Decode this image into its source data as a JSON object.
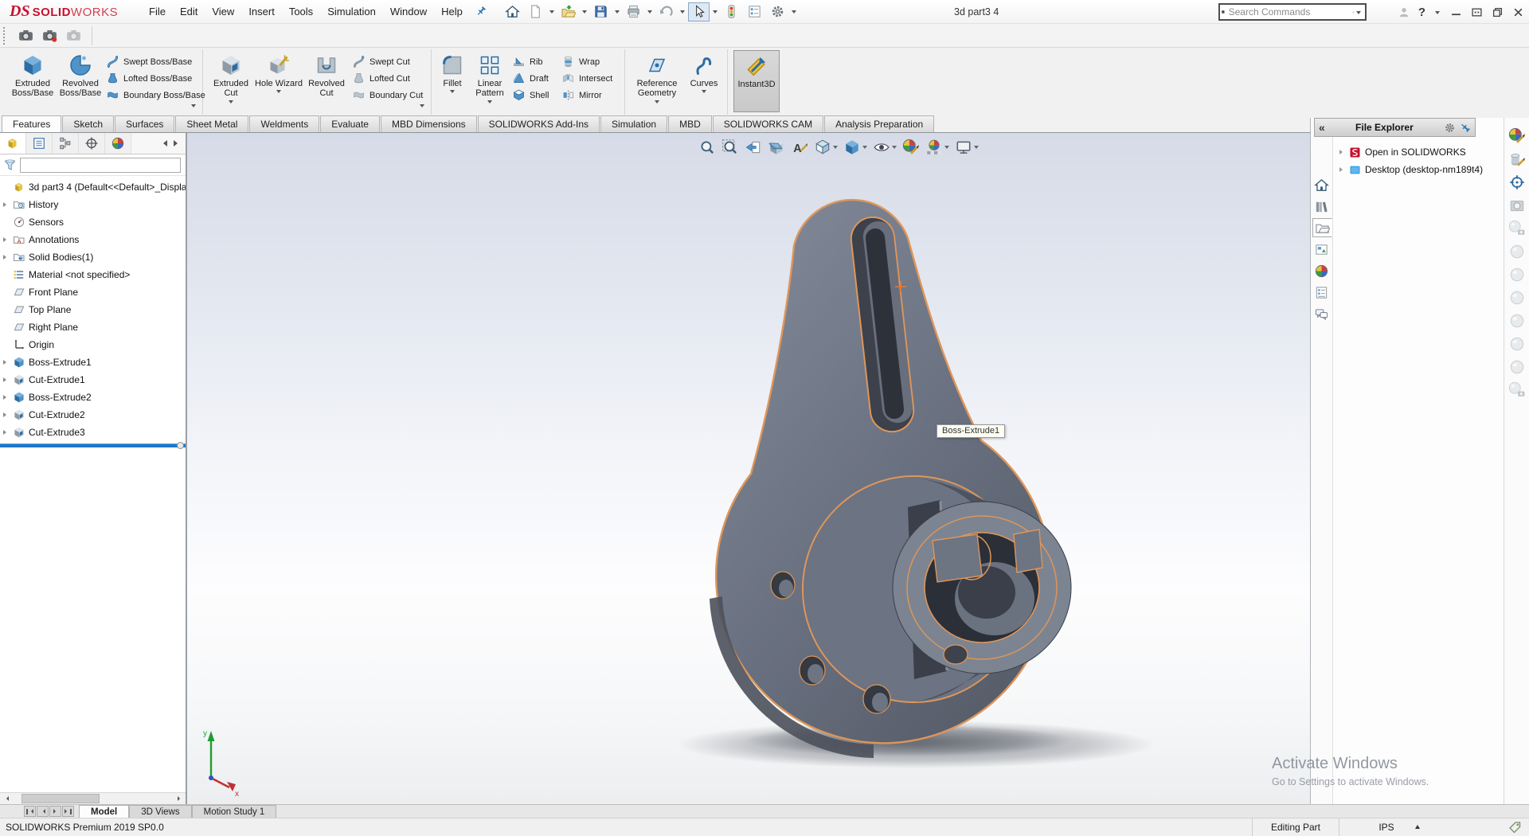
{
  "titlebar": {
    "logo_mark": "DS",
    "logo_solid": "SOLID",
    "logo_works": "WORKS",
    "menus": [
      "File",
      "Edit",
      "View",
      "Insert",
      "Tools",
      "Simulation",
      "Window",
      "Help"
    ],
    "document_title": "3d part3 4",
    "search_placeholder": "Search Commands",
    "help_label": "?"
  },
  "quick_access_icons": [
    "home",
    "new-document",
    "open",
    "save",
    "print",
    "undo",
    "select-cursor",
    "rebuild-traffic-light",
    "options-list",
    "settings-gear"
  ],
  "capture_toolbar_icons": [
    "screen-capture-camera",
    "record-video-camera",
    "copy-capture-disabled"
  ],
  "ribbon": {
    "group1": {
      "big": [
        "Extruded Boss/Base",
        "Revolved Boss/Base"
      ],
      "small": [
        "Swept Boss/Base",
        "Lofted Boss/Base",
        "Boundary Boss/Base"
      ]
    },
    "group2": {
      "big": [
        "Extruded Cut",
        "Hole Wizard",
        "Revolved Cut"
      ],
      "small": [
        "Swept Cut",
        "Lofted Cut",
        "Boundary Cut"
      ]
    },
    "group3": {
      "big": [
        "Fillet",
        "Linear Pattern"
      ],
      "colA": [
        "Rib",
        "Draft",
        "Shell"
      ],
      "colB": [
        "Wrap",
        "Intersect",
        "Mirror"
      ]
    },
    "group4": {
      "big": [
        "Reference Geometry",
        "Curves"
      ]
    },
    "group5": {
      "big": [
        "Instant3D"
      ]
    }
  },
  "command_tabs": [
    "Features",
    "Sketch",
    "Surfaces",
    "Sheet Metal",
    "Weldments",
    "Evaluate",
    "MBD Dimensions",
    "SOLIDWORKS Add-Ins",
    "Simulation",
    "MBD",
    "SOLIDWORKS CAM",
    "Analysis Preparation"
  ],
  "feature_tree": {
    "root": "3d part3 4  (Default<<Default>_Displa",
    "items": [
      "History",
      "Sensors",
      "Annotations",
      "Solid Bodies(1)",
      "Material <not specified>",
      "Front Plane",
      "Top Plane",
      "Right Plane",
      "Origin",
      "Boss-Extrude1",
      "Cut-Extrude1",
      "Boss-Extrude2",
      "Cut-Extrude2",
      "Cut-Extrude3"
    ]
  },
  "panel_tab_icons": [
    "feature-manager",
    "property-manager",
    "configuration-manager",
    "dimxpert-manager",
    "display-manager"
  ],
  "headsup_icons": [
    "zoom-to-fit",
    "zoom-to-area",
    "previous-view",
    "section-view",
    "dynamic-annotation-views",
    "view-orientation",
    "display-style",
    "hide-show-items",
    "edit-appearance",
    "apply-scene",
    "view-settings"
  ],
  "viewport": {
    "tooltip": "Boss-Extrude1",
    "watermark_title": "Activate Windows",
    "watermark_subtitle": "Go to Settings to activate Windows."
  },
  "file_explorer": {
    "collapse_glyph": "«",
    "title": "File Explorer",
    "items": [
      "Open in SOLIDWORKS",
      "Desktop (desktop-nm189t4)"
    ]
  },
  "task_pane_tab_icons": [
    "solidworks-resources",
    "design-library",
    "file-explorer",
    "view-palette",
    "appearances-scenes",
    "custom-properties",
    "solidworks-forum"
  ],
  "render_tool_icons": [
    "edit-appearance",
    "edit-scene",
    "render-target",
    "preview-window",
    "render-camera",
    "render-option-1",
    "render-option-2",
    "render-option-3",
    "render-option-4",
    "render-option-5",
    "render-option-6",
    "render-option-7"
  ],
  "sheet_tabs": [
    "Model",
    "3D Views",
    "Motion Study 1"
  ],
  "statusbar": {
    "left": "SOLIDWORKS Premium 2019 SP0.0",
    "mode": "Editing Part",
    "units": "IPS"
  },
  "colors": {
    "accent_blue": "#2878b7",
    "selection_orange": "#de9659",
    "part_light": "#7e8595",
    "part_dark": "#4d5360",
    "logo_red": "#c8102e"
  }
}
